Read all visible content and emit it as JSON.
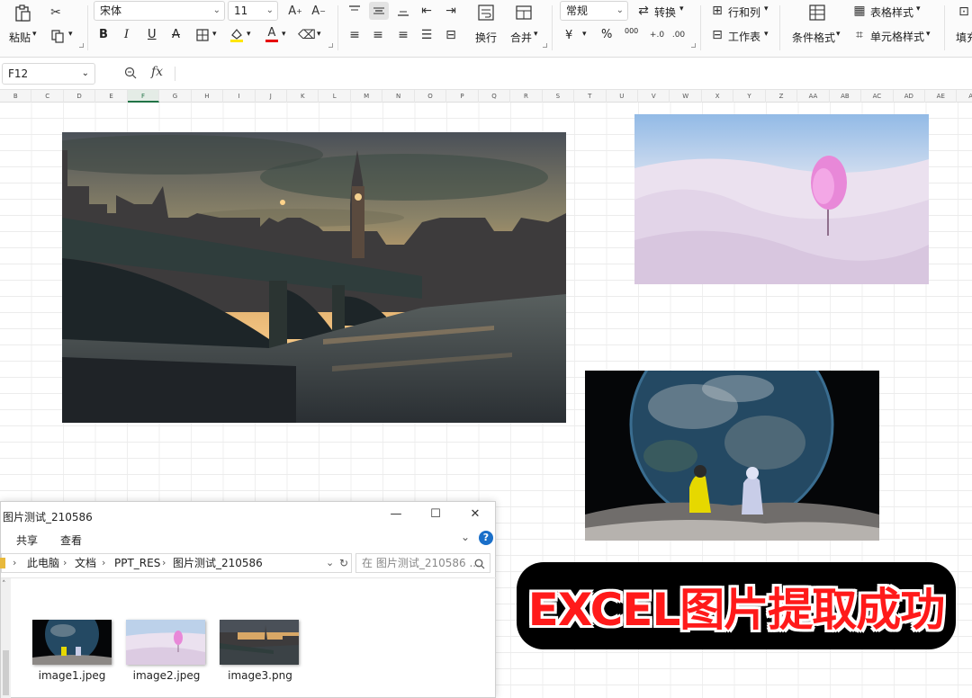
{
  "ribbon": {
    "paste": "粘贴",
    "font_name": "宋体",
    "font_size": "11",
    "wrap": "换行",
    "merge": "合并",
    "number_format": "常规",
    "convert": "转换",
    "rows_cols": "行和列",
    "worksheet": "工作表",
    "cond_format": "条件格式",
    "table_style": "表格样式",
    "cell_style": "单元格样式",
    "fill": "填充",
    "bold": "B",
    "italic": "I",
    "underline": "U",
    "strike": "A",
    "font_color": "A",
    "percent": "%",
    "thousands": "000",
    "currency": "¥"
  },
  "formula_bar": {
    "cell_ref": "F12",
    "fx": "fx",
    "value": ""
  },
  "columns": [
    "B",
    "C",
    "D",
    "E",
    "F",
    "G",
    "H",
    "I",
    "J",
    "K",
    "L",
    "M",
    "N",
    "O",
    "P",
    "Q",
    "R",
    "S",
    "T",
    "U",
    "V",
    "W",
    "X",
    "Y",
    "Z",
    "AA",
    "AB",
    "AC",
    "AD",
    "AE",
    "AF"
  ],
  "selected_column": "F",
  "explorer": {
    "title": "图片测试_210586",
    "tabs": [
      "共享",
      "查看"
    ],
    "breadcrumb": [
      "此电脑",
      "文档",
      "PPT_RES",
      "图片测试_210586"
    ],
    "search_placeholder": "在 图片测试_210586 ...",
    "files": [
      {
        "name": "image1.jpeg",
        "icon": "earth-thumbnail"
      },
      {
        "name": "image2.jpeg",
        "icon": "pink-tree-thumbnail"
      },
      {
        "name": "image3.png",
        "icon": "london-thumbnail"
      }
    ]
  },
  "banner": {
    "text": "EXCEL图片提取成功",
    "color": "#ff1a1a"
  },
  "colors": {
    "excel_green": "#217346",
    "ribbon_bg": "#fbfbfb"
  }
}
